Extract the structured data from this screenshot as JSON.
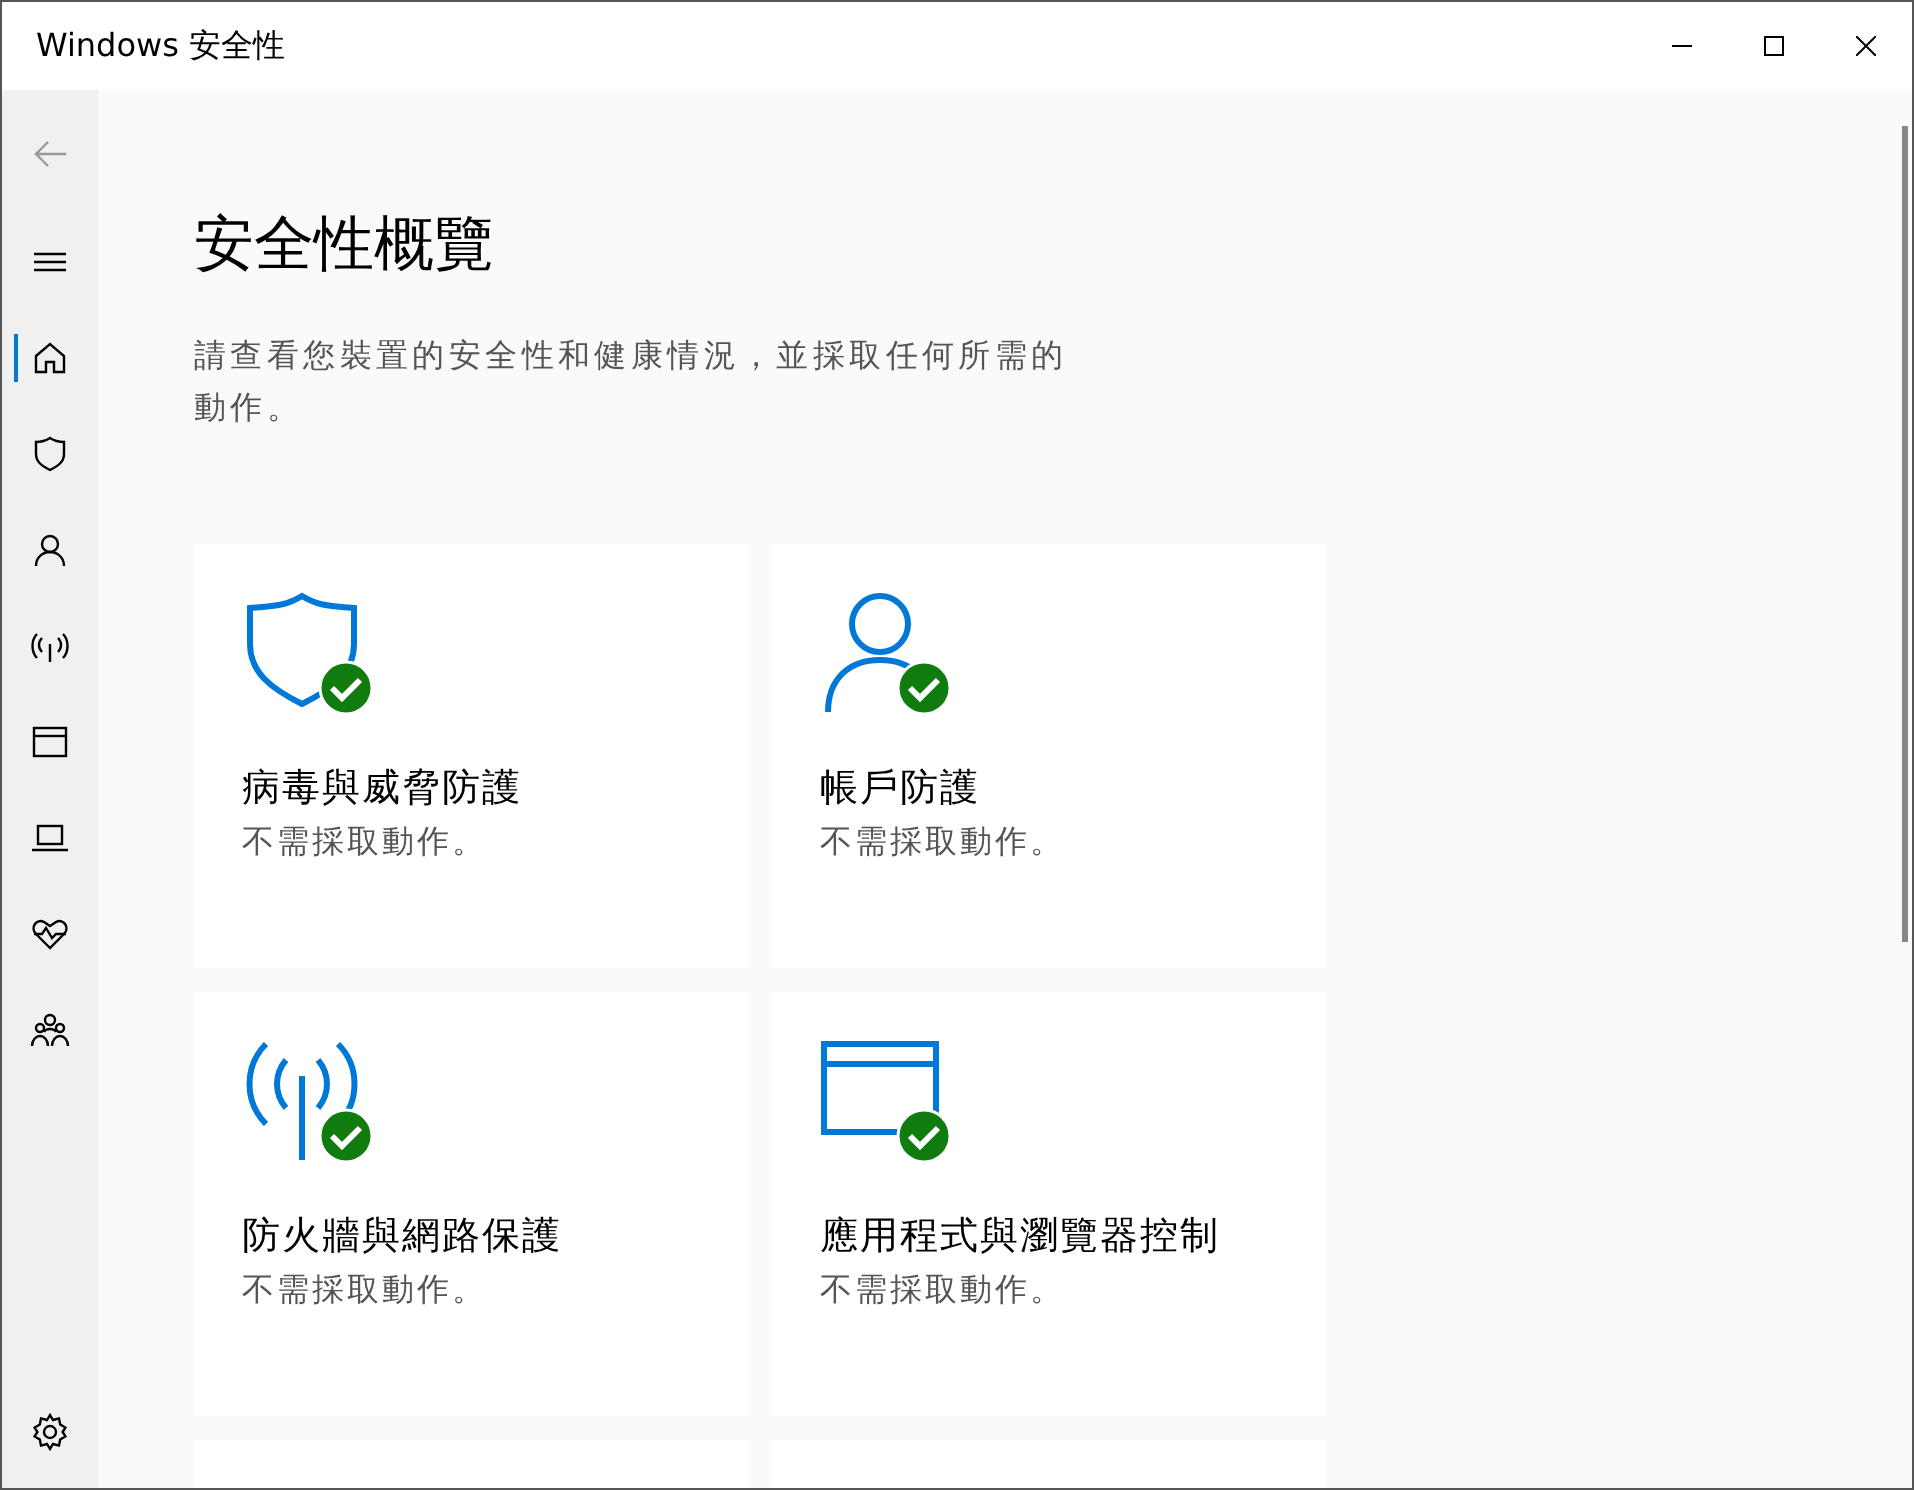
{
  "window": {
    "title": "Windows 安全性"
  },
  "sidebar": {
    "items": [
      {
        "kind": "back",
        "selected": false
      },
      {
        "kind": "menu",
        "selected": false
      },
      {
        "kind": "home",
        "selected": true
      },
      {
        "kind": "shield",
        "selected": false
      },
      {
        "kind": "person",
        "selected": false
      },
      {
        "kind": "antenna",
        "selected": false
      },
      {
        "kind": "browser",
        "selected": false
      },
      {
        "kind": "laptop",
        "selected": false
      },
      {
        "kind": "heart",
        "selected": false
      },
      {
        "kind": "family",
        "selected": false
      },
      {
        "kind": "settings",
        "selected": false
      }
    ]
  },
  "page": {
    "heading": "安全性概覽",
    "description": "請查看您裝置的安全性和健康情況，並採取任何所需的動作。"
  },
  "cards": [
    {
      "kind": "shield",
      "title": "病毒與威脅防護",
      "status": "不需採取動作。",
      "ok": true
    },
    {
      "kind": "person",
      "title": "帳戶防護",
      "status": "不需採取動作。",
      "ok": true
    },
    {
      "kind": "antenna",
      "title": "防火牆與網路保護",
      "status": "不需採取動作。",
      "ok": true
    },
    {
      "kind": "browser",
      "title": "應用程式與瀏覽器控制",
      "status": "不需採取動作。",
      "ok": true
    },
    {
      "kind": "blank"
    },
    {
      "kind": "blank"
    }
  ]
}
